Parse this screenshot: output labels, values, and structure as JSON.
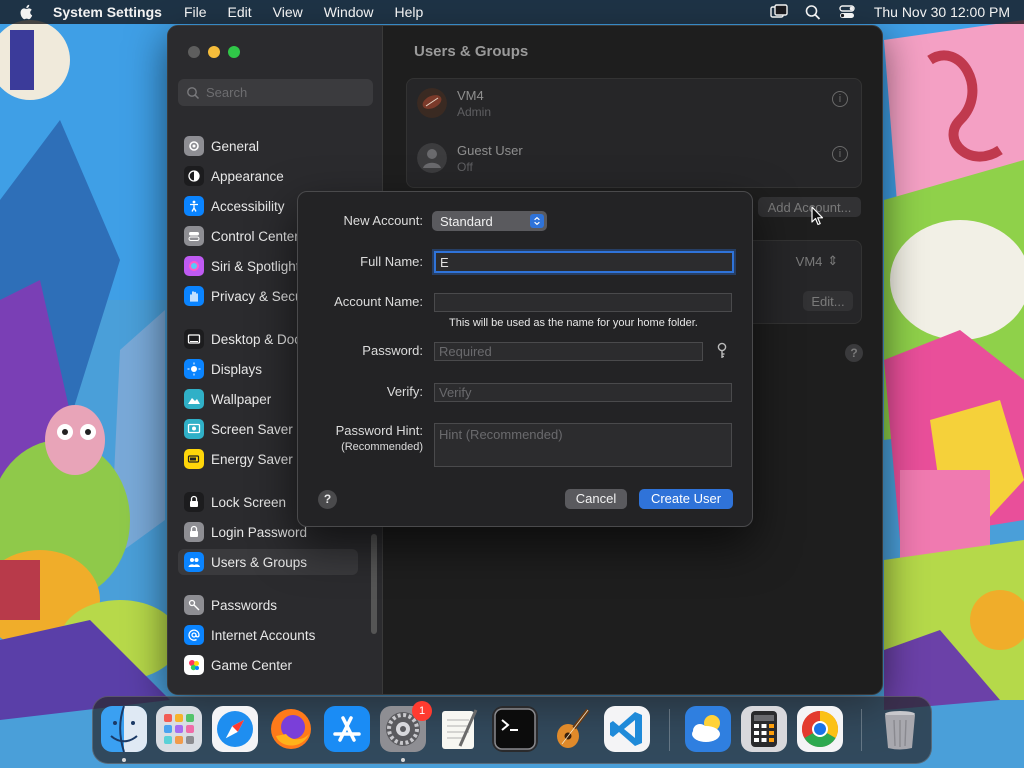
{
  "menubar": {
    "app_name": "System Settings",
    "items": [
      "File",
      "Edit",
      "View",
      "Window",
      "Help"
    ],
    "clock": "Thu Nov 30  12:00 PM"
  },
  "sidebar": {
    "search_placeholder": "Search",
    "items": [
      {
        "label": "General",
        "icon": "gear-icon",
        "color": "#8e8e93"
      },
      {
        "label": "Appearance",
        "icon": "appearance-icon",
        "color": "#1c1c1e"
      },
      {
        "label": "Accessibility",
        "icon": "accessibility-icon",
        "color": "#0a84ff"
      },
      {
        "label": "Control Center",
        "icon": "control-center-icon",
        "color": "#8e8e93"
      },
      {
        "label": "Siri & Spotlight",
        "icon": "siri-icon",
        "color": "#bf5af2"
      },
      {
        "label": "Privacy & Security",
        "icon": "hand-icon",
        "color": "#0a84ff"
      },
      {
        "label": "Desktop & Dock",
        "icon": "desktop-icon",
        "color": "#1c1c1e"
      },
      {
        "label": "Displays",
        "icon": "sun-icon",
        "color": "#0a84ff"
      },
      {
        "label": "Wallpaper",
        "icon": "wallpaper-icon",
        "color": "#30b0c7"
      },
      {
        "label": "Screen Saver",
        "icon": "screen-saver-icon",
        "color": "#30b0c7"
      },
      {
        "label": "Energy Saver",
        "icon": "battery-icon",
        "color": "#ffd60a"
      },
      {
        "label": "Lock Screen",
        "icon": "lock-icon",
        "color": "#1c1c1e"
      },
      {
        "label": "Login Password",
        "icon": "lock-icon",
        "color": "#8e8e93"
      },
      {
        "label": "Users & Groups",
        "icon": "users-icon",
        "color": "#0a84ff"
      },
      {
        "label": "Passwords",
        "icon": "key-icon",
        "color": "#8e8e93"
      },
      {
        "label": "Internet Accounts",
        "icon": "at-icon",
        "color": "#0a84ff"
      },
      {
        "label": "Game Center",
        "icon": "game-center-icon",
        "color": "#ffffff"
      }
    ]
  },
  "content": {
    "title": "Users & Groups",
    "users": [
      {
        "name": "VM4",
        "role": "Admin"
      },
      {
        "name": "Guest User",
        "role": "Off"
      }
    ],
    "add_account_label": "Add Account...",
    "autologin_value": "VM4",
    "edit_label": "Edit...",
    "help_label": "?"
  },
  "dialog": {
    "new_account_label": "New Account:",
    "account_type": "Standard",
    "full_name_label": "Full Name:",
    "full_name_value": "E",
    "account_name_label": "Account Name:",
    "account_name_value": "",
    "home_folder_note": "This will be used as the name for your home folder.",
    "password_label": "Password:",
    "password_placeholder": "Required",
    "verify_label": "Verify:",
    "verify_placeholder": "Verify",
    "hint_label": "Password Hint:",
    "hint_sublabel": "(Recommended)",
    "hint_placeholder": "Hint (Recommended)",
    "help_label": "?",
    "cancel_label": "Cancel",
    "create_label": "Create User"
  },
  "dock": {
    "apps": [
      "finder-icon",
      "launchpad-icon",
      "safari-icon",
      "firefox-icon",
      "app-store-icon",
      "system-settings-icon",
      "textedit-icon",
      "terminal-icon",
      "garageband-icon",
      "vscode-icon",
      "weather-icon",
      "calculator-icon",
      "chrome-icon",
      "trash-icon"
    ],
    "settings_badge": "1"
  },
  "colors": {
    "accent": "#2f73d9",
    "badge": "#ff3b30"
  }
}
